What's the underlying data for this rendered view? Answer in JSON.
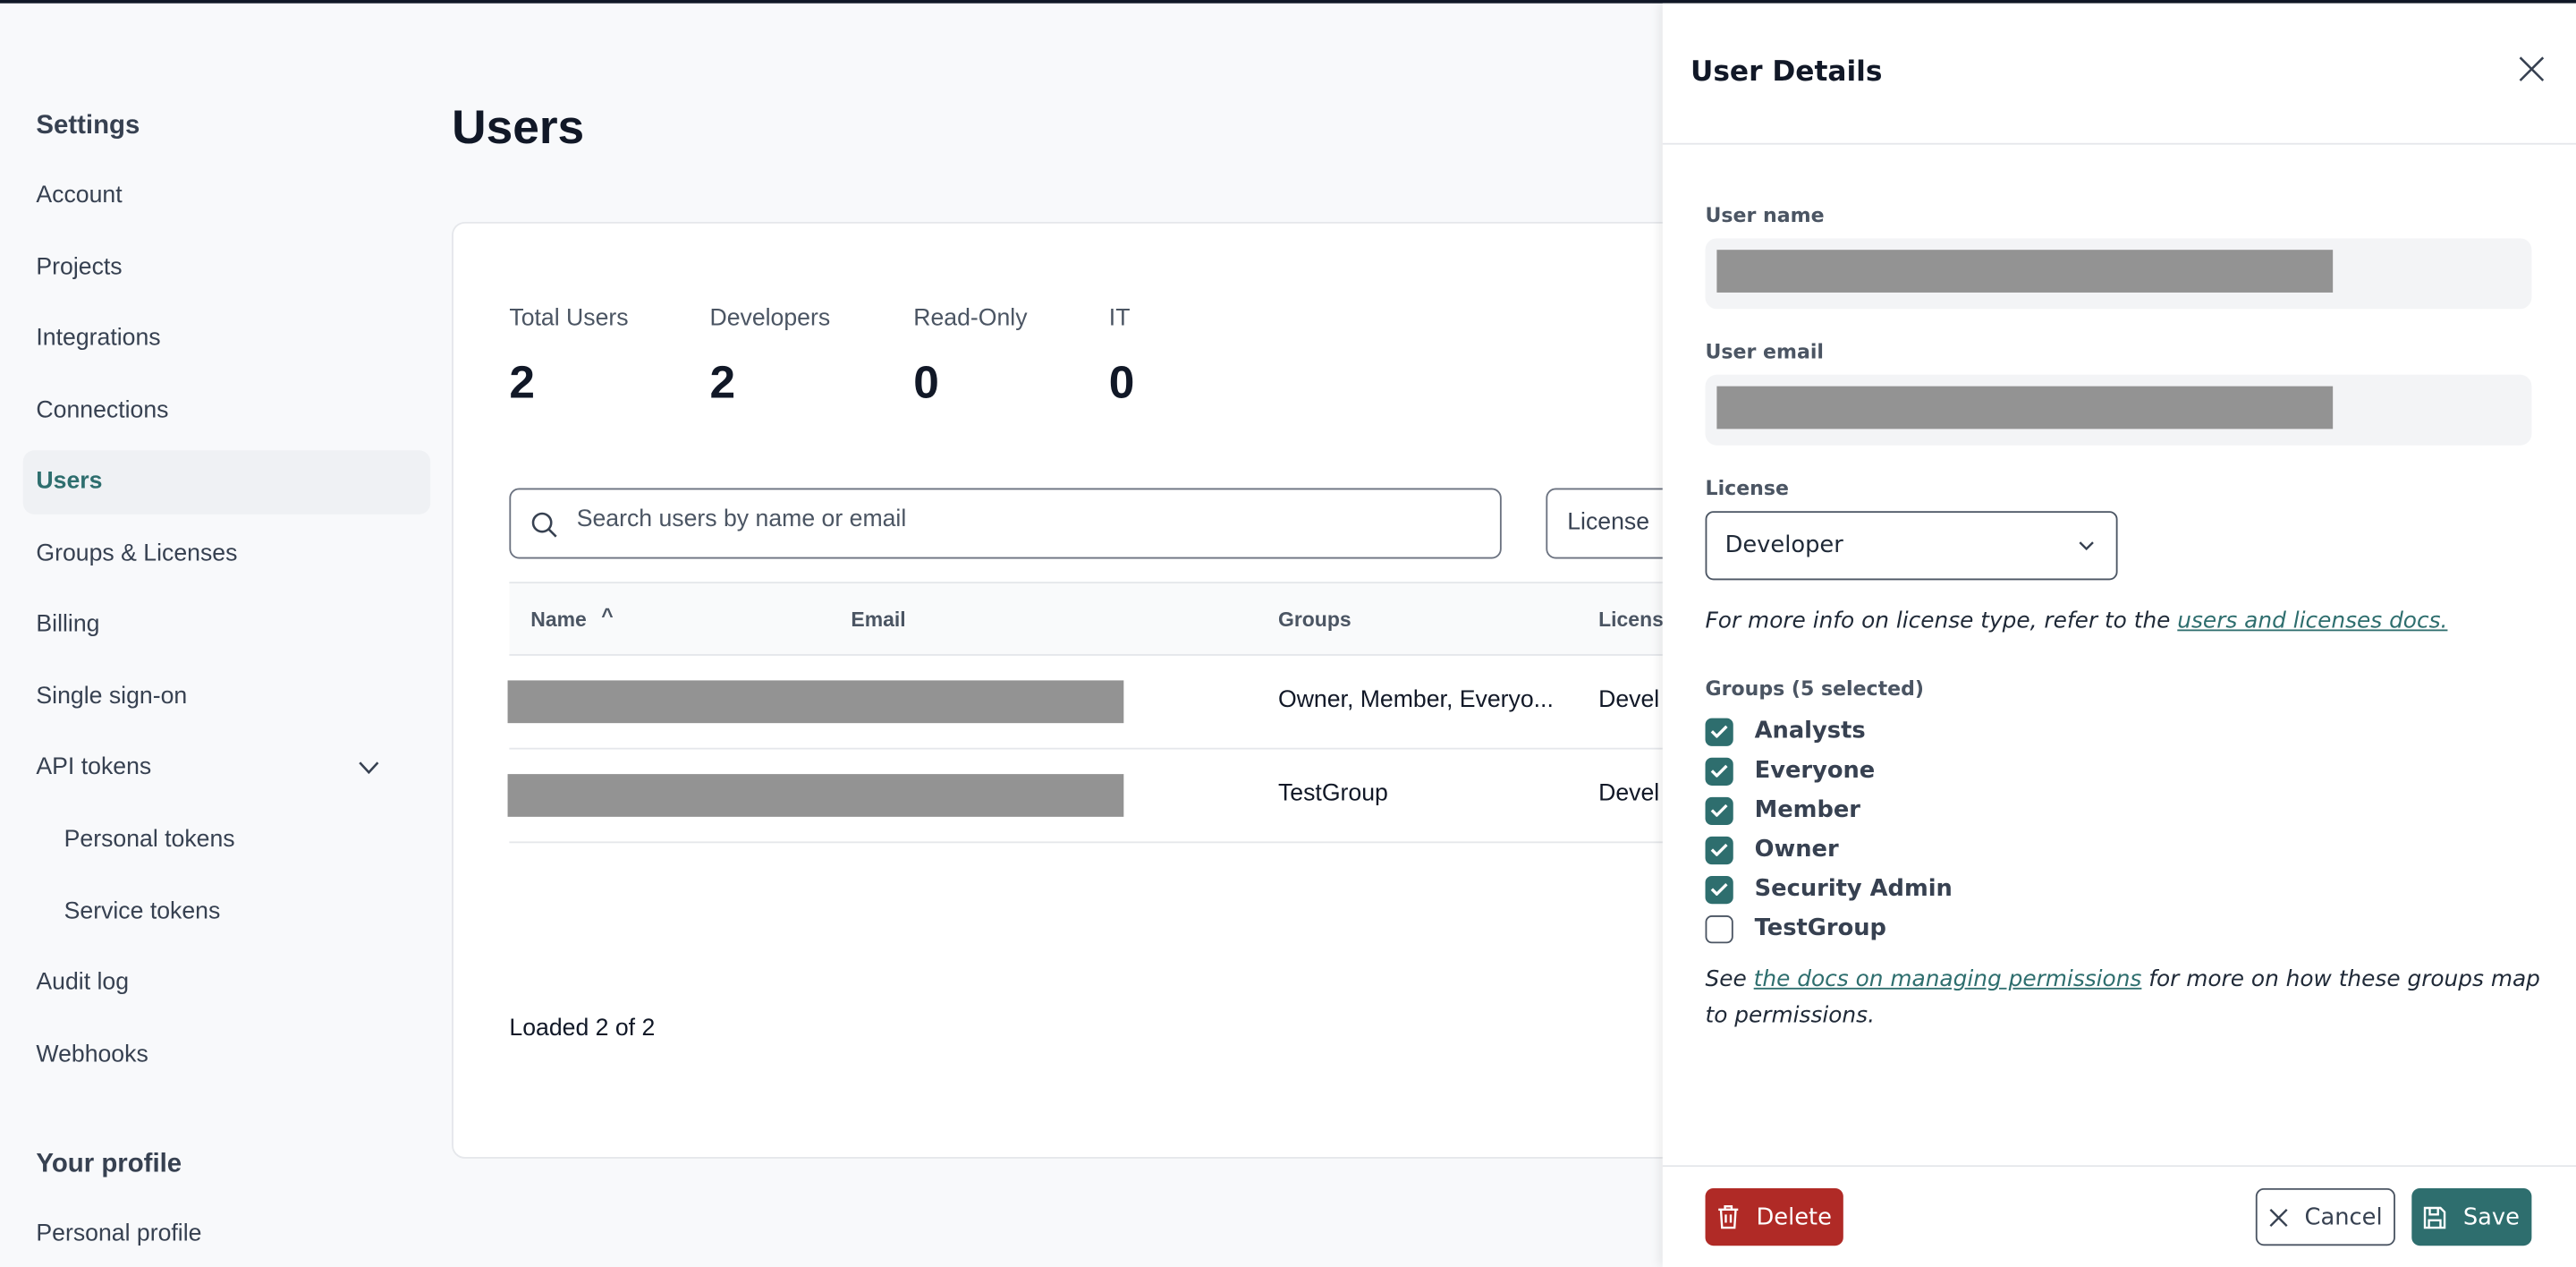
{
  "sidebar": {
    "title": "Settings",
    "items": [
      {
        "label": "Account"
      },
      {
        "label": "Projects"
      },
      {
        "label": "Integrations"
      },
      {
        "label": "Connections"
      },
      {
        "label": "Users",
        "active": true
      },
      {
        "label": "Groups & Licenses"
      },
      {
        "label": "Billing"
      },
      {
        "label": "Single sign-on"
      },
      {
        "label": "API tokens"
      },
      {
        "label": "Personal tokens"
      },
      {
        "label": "Service tokens"
      },
      {
        "label": "Audit log"
      },
      {
        "label": "Webhooks"
      }
    ],
    "profile_title": "Your profile",
    "profile_items": [
      {
        "label": "Personal profile"
      }
    ]
  },
  "main": {
    "title": "Users",
    "stats": [
      {
        "label": "Total Users",
        "value": "2"
      },
      {
        "label": "Developers",
        "value": "2"
      },
      {
        "label": "Read-Only",
        "value": "0"
      },
      {
        "label": "IT",
        "value": "0"
      }
    ],
    "search": {
      "placeholder": "Search users by name or email",
      "value": ""
    },
    "license_filter": "License",
    "table": {
      "columns": [
        "Name",
        "Email",
        "Groups",
        "License"
      ],
      "sort_indicator": "^",
      "rows": [
        {
          "groups": "Owner, Member, Everyo...",
          "license": "Devel"
        },
        {
          "groups": "TestGroup",
          "license": "Devel"
        }
      ]
    },
    "footer": "Loaded 2 of 2"
  },
  "drawer": {
    "title": "User Details",
    "user_name_label": "User name",
    "user_email_label": "User email",
    "license_label": "License",
    "license_value": "Developer",
    "license_note": "For more info on license type, refer to the ",
    "license_link": "users and licenses docs.",
    "groups_label": "Groups (5 selected)",
    "groups": [
      {
        "label": "Analysts",
        "checked": true
      },
      {
        "label": "Everyone",
        "checked": true
      },
      {
        "label": "Member",
        "checked": true
      },
      {
        "label": "Owner",
        "checked": true
      },
      {
        "label": "Security Admin",
        "checked": true
      },
      {
        "label": "TestGroup",
        "checked": false
      }
    ],
    "perm_pre": "See ",
    "perm_link": "the docs on managing permissions",
    "perm_post": " for more on how these groups map to permissions.",
    "delete_label": "Delete",
    "cancel_label": "Cancel",
    "save_label": "Save"
  },
  "colors": {
    "accent": "#2e6e6e",
    "danger": "#b02a26"
  }
}
